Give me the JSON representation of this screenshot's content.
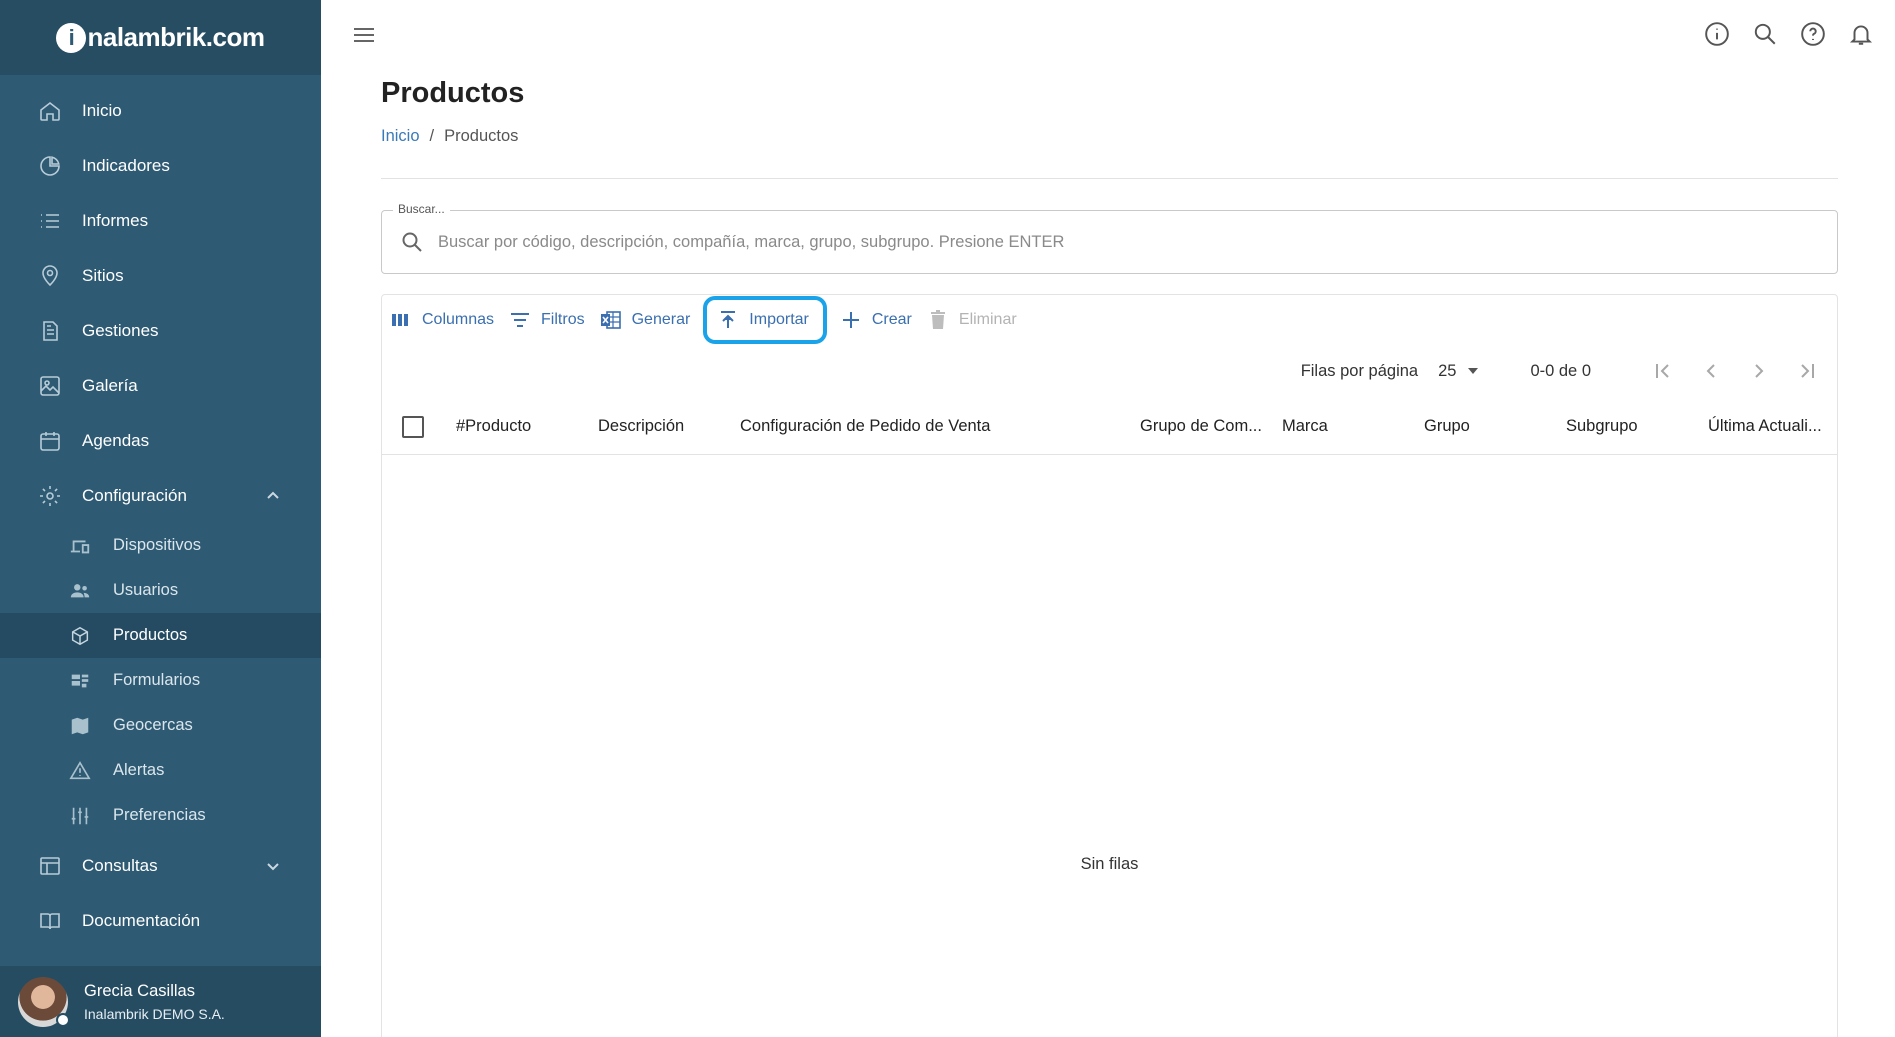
{
  "brand": {
    "logo_letter": "i",
    "logo_text": "nalambrik.com"
  },
  "sidebar": {
    "items": [
      {
        "label": "Inicio",
        "icon": "home-icon"
      },
      {
        "label": "Indicadores",
        "icon": "pie-chart-icon"
      },
      {
        "label": "Informes",
        "icon": "list-icon"
      },
      {
        "label": "Sitios",
        "icon": "map-pin-icon"
      },
      {
        "label": "Gestiones",
        "icon": "document-icon"
      },
      {
        "label": "Galería",
        "icon": "image-icon"
      },
      {
        "label": "Agendas",
        "icon": "calendar-icon"
      },
      {
        "label": "Configuración",
        "icon": "gear-icon"
      }
    ],
    "config_sub": [
      {
        "label": "Dispositivos",
        "icon": "devices-icon"
      },
      {
        "label": "Usuarios",
        "icon": "users-icon"
      },
      {
        "label": "Productos",
        "icon": "cube-icon"
      },
      {
        "label": "Formularios",
        "icon": "form-icon"
      },
      {
        "label": "Geocercas",
        "icon": "map-icon"
      },
      {
        "label": "Alertas",
        "icon": "warning-icon"
      },
      {
        "label": "Preferencias",
        "icon": "sliders-icon"
      }
    ],
    "bottom_items": [
      {
        "label": "Consultas",
        "icon": "table-icon"
      },
      {
        "label": "Documentación",
        "icon": "book-icon"
      }
    ],
    "user": {
      "name": "Grecia Casillas",
      "org": "Inalambrik DEMO S.A."
    }
  },
  "page": {
    "title": "Productos",
    "breadcrumb": {
      "home": "Inicio",
      "separator": "/",
      "current": "Productos"
    }
  },
  "search": {
    "legend": "Buscar...",
    "placeholder": "Buscar por código, descripción, compañía, marca, grupo, subgrupo. Presione ENTER",
    "value": ""
  },
  "toolbar": {
    "columns": "Columnas",
    "filters": "Filtros",
    "generate": "Generar",
    "import": "Importar",
    "create": "Crear",
    "delete": "Eliminar"
  },
  "pager": {
    "rows_label": "Filas por página",
    "rows_value": "25",
    "range": "0-0 de 0"
  },
  "table": {
    "headers": [
      "#Producto",
      "Descripción",
      "Configuración de Pedido de Venta",
      "Grupo de Com...",
      "Marca",
      "Grupo",
      "Subgrupo",
      "Última Actuali..."
    ],
    "empty": "Sin filas"
  },
  "colors": {
    "sidebar": "#2e5a73",
    "accent": "#3a6fb0",
    "highlight": "#1aa3e8"
  }
}
